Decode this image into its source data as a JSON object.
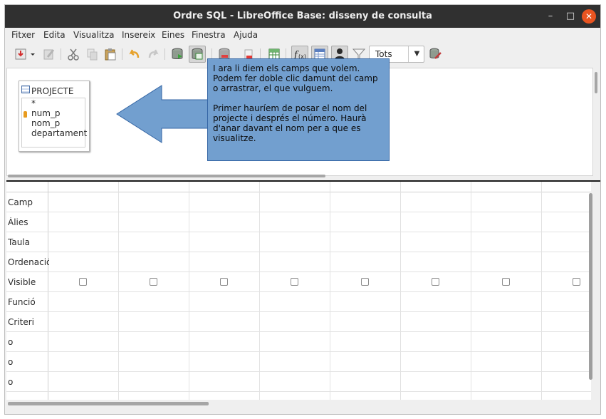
{
  "window": {
    "title": "Ordre SQL - LibreOffice Base: disseny de consulta",
    "controls": {
      "minimize": "–",
      "maximize": "□",
      "close": "✕"
    }
  },
  "menubar": {
    "items": [
      "Fitxer",
      "Edita",
      "Visualitza",
      "Insereix",
      "Eines",
      "Finestra",
      "Ajuda"
    ]
  },
  "toolbar": {
    "icons": [
      "save-icon",
      "dropdown-arrow-icon",
      "edit-icon",
      "cut-icon",
      "copy-icon",
      "paste-icon",
      "undo-icon",
      "redo-icon",
      "run-query-icon",
      "design-view-icon",
      "clear-query-icon",
      "delete-icon",
      "add-table-icon",
      "functions-icon",
      "table-names-icon",
      "alias-icon",
      "distinct-values-icon",
      "sql-native-icon"
    ],
    "limit": {
      "selected": "Tots"
    }
  },
  "table": {
    "name": "PROJECTE",
    "fields": [
      "*",
      "num_p",
      "nom_p",
      "departament"
    ]
  },
  "callout": {
    "paragraph1": "I ara li diem els camps que volem. Podem fer doble clic damunt del camp o arrastrar, el que vulguem.",
    "paragraph2": "Primer hauríem de posar el nom del projecte i després el número. Haurà d'anar davant el nom per a que es visualitze."
  },
  "grid": {
    "rows": [
      "Camp",
      "Àlies",
      "Taula",
      "Ordenació",
      "Visible",
      "Funció",
      "Criteri",
      "o",
      "o",
      "o"
    ],
    "columns": 8
  },
  "colors": {
    "titlebar": "#303030",
    "close_button": "#e95420",
    "callout_fill": "#729fcf",
    "callout_border": "#3465a4"
  }
}
